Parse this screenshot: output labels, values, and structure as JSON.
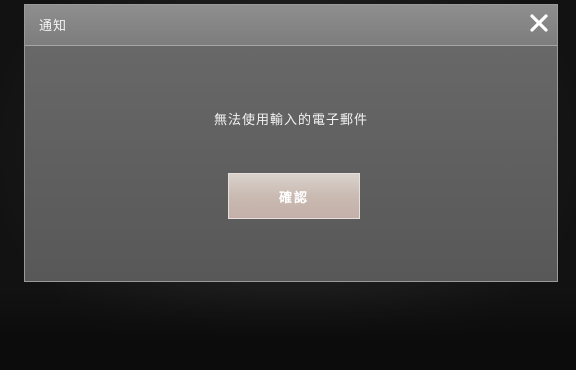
{
  "dialog": {
    "title": "通知",
    "close_icon": "close-icon",
    "message": "無法使用輸入的電子郵件",
    "confirm_label": "確認"
  },
  "colors": {
    "titlebar": "#858585",
    "dialog_body": "#626262",
    "button": "#cbbab2",
    "text": "#f4f4f4"
  }
}
